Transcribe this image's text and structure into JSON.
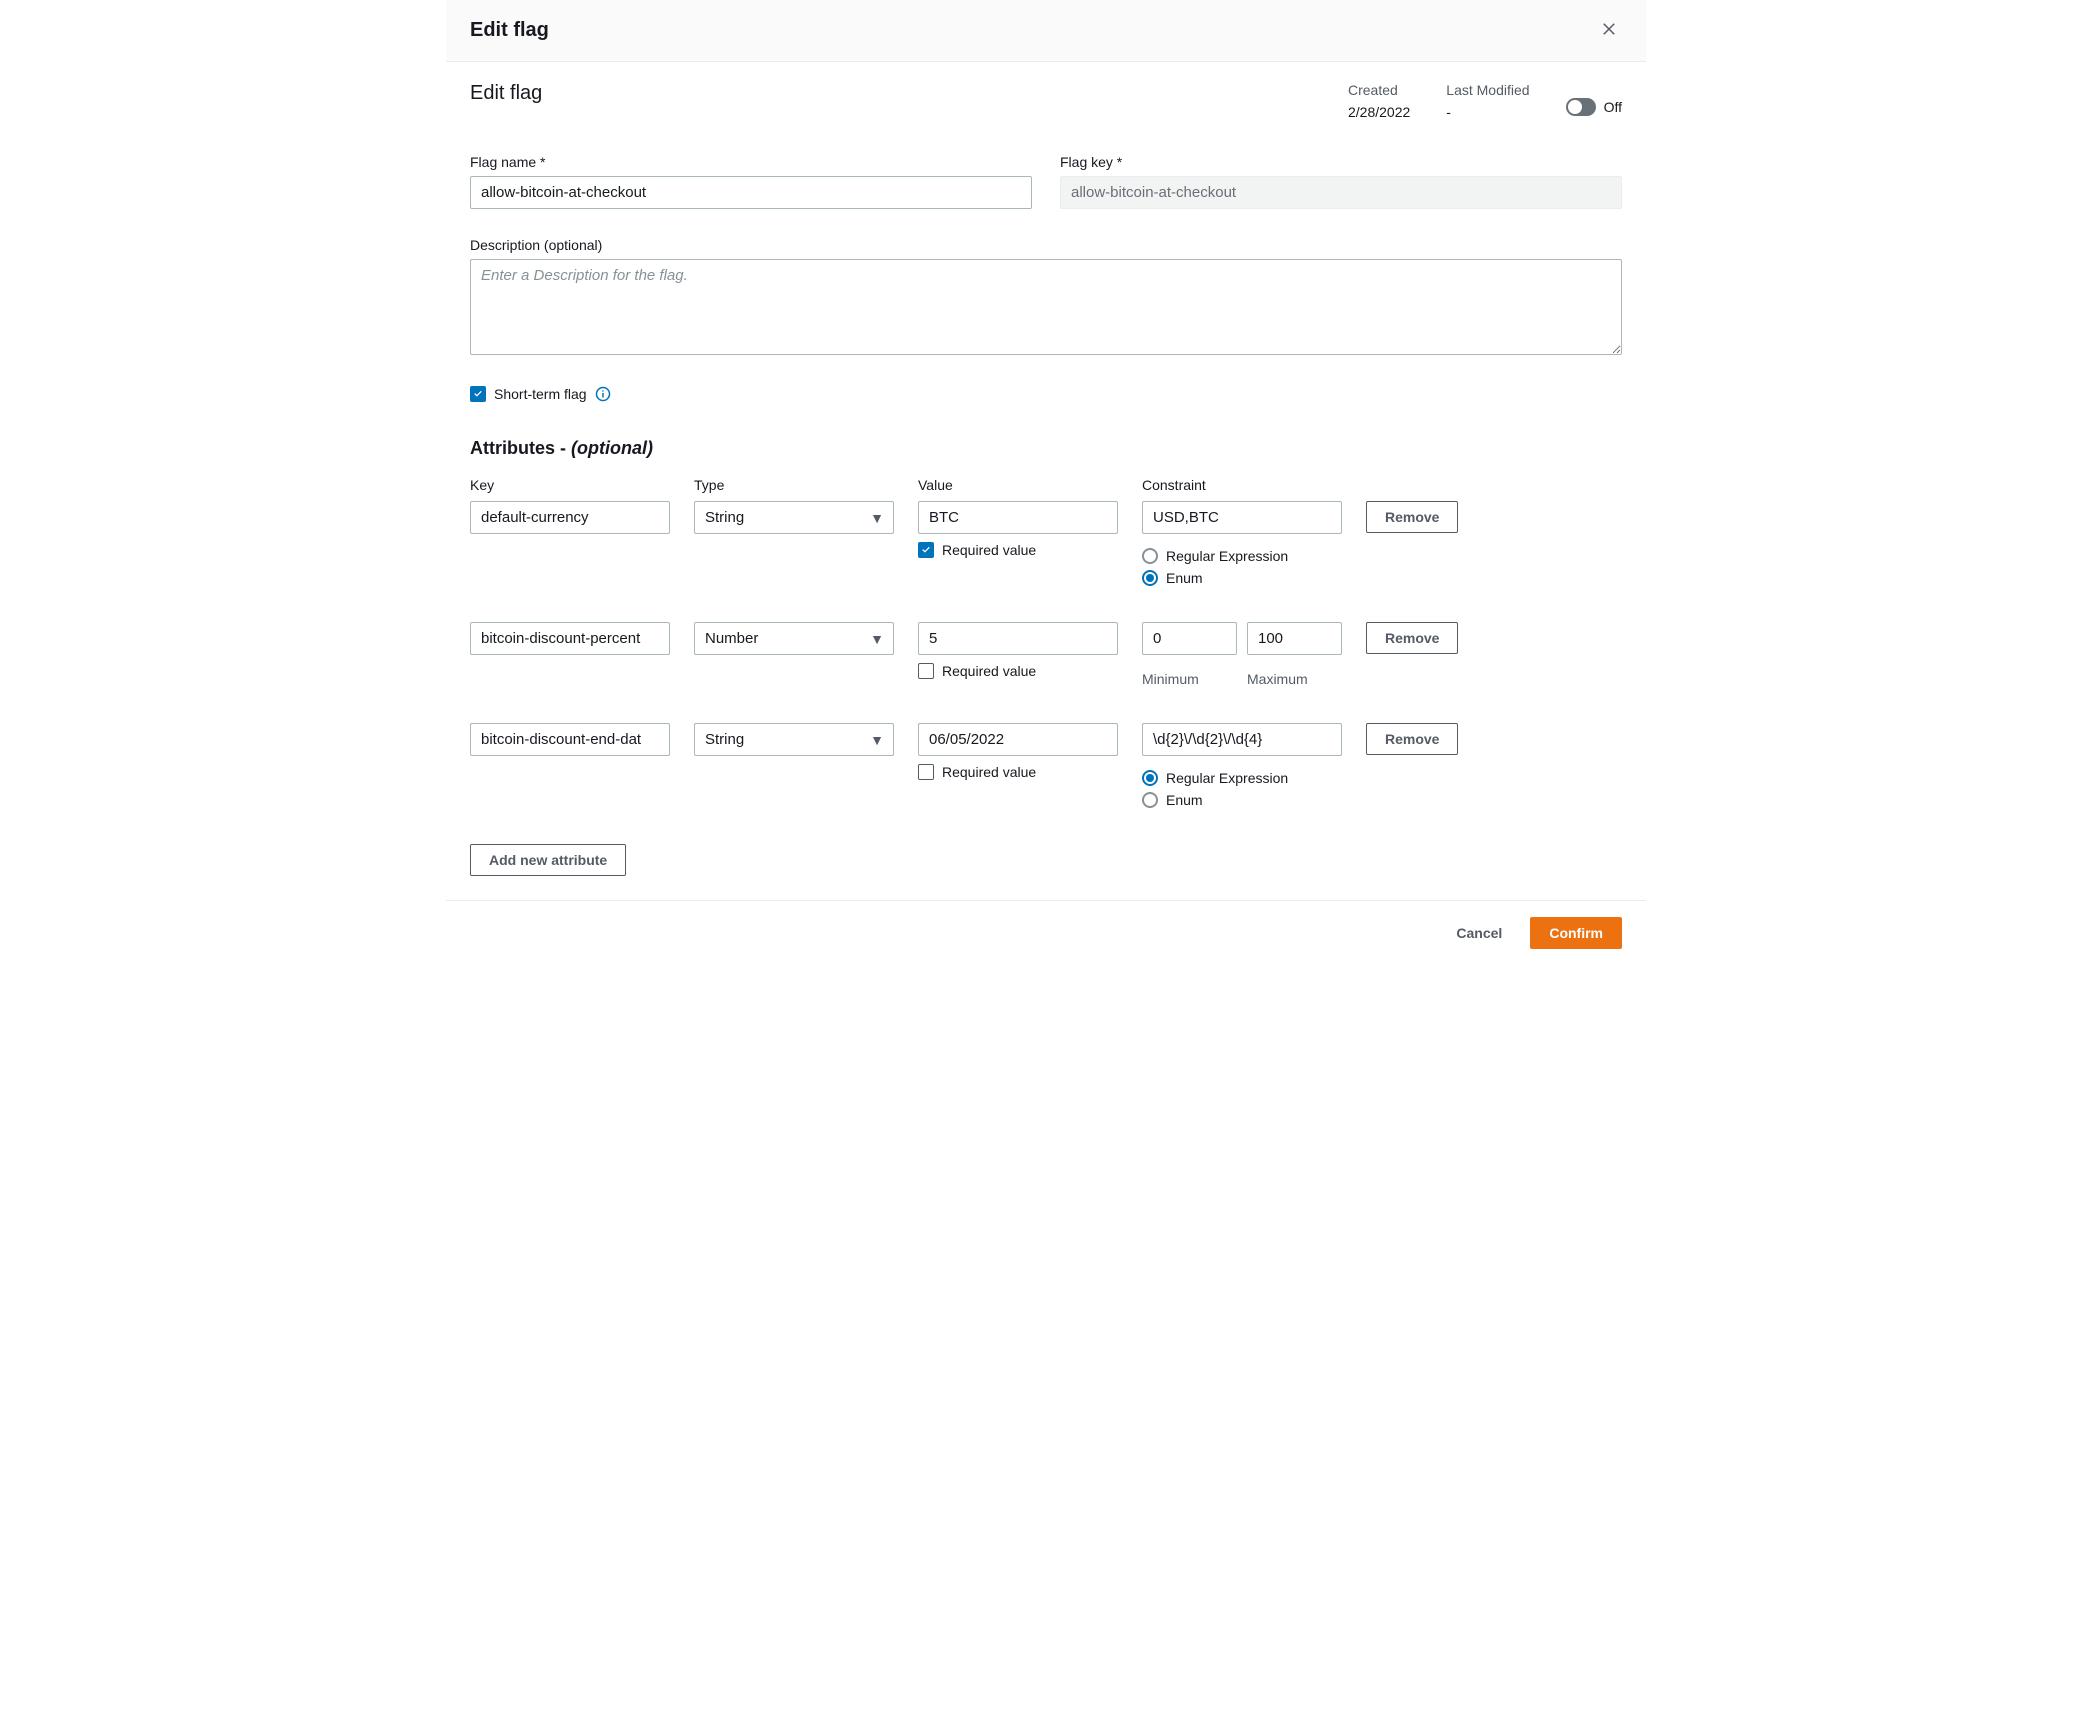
{
  "modalTitle": "Edit flag",
  "subtitle": "Edit flag",
  "meta": {
    "createdLabel": "Created",
    "createdValue": "2/28/2022",
    "modifiedLabel": "Last Modified",
    "modifiedValue": "-"
  },
  "toggle": {
    "state": "Off"
  },
  "fields": {
    "flagNameLabel": "Flag name *",
    "flagNameValue": "allow-bitcoin-at-checkout",
    "flagKeyLabel": "Flag key *",
    "flagKeyValue": "allow-bitcoin-at-checkout",
    "descriptionLabel": "Description (optional)",
    "descriptionPlaceholder": "Enter a Description for the flag.",
    "shortTermLabel": "Short-term flag"
  },
  "attributes": {
    "title": "Attributes - ",
    "optional": "(optional)",
    "headers": {
      "key": "Key",
      "type": "Type",
      "value": "Value",
      "constraint": "Constraint"
    },
    "labels": {
      "requiredValue": "Required value",
      "regex": "Regular Expression",
      "enum": "Enum",
      "minimum": "Minimum",
      "maximum": "Maximum",
      "remove": "Remove",
      "addNew": "Add new attribute"
    },
    "rows": [
      {
        "key": "default-currency",
        "type": "String",
        "value": "BTC",
        "requiredChecked": true,
        "constraintMode": "enum",
        "constraintValue": "USD,BTC"
      },
      {
        "key": "bitcoin-discount-percent",
        "type": "Number",
        "value": "5",
        "requiredChecked": false,
        "constraintMode": "range",
        "min": "0",
        "max": "100"
      },
      {
        "key": "bitcoin-discount-end-dat",
        "type": "String",
        "value": "06/05/2022",
        "requiredChecked": false,
        "constraintMode": "regex",
        "constraintValue": "\\d{2}\\/\\d{2}\\/\\d{4}"
      }
    ]
  },
  "footer": {
    "cancel": "Cancel",
    "confirm": "Confirm"
  }
}
